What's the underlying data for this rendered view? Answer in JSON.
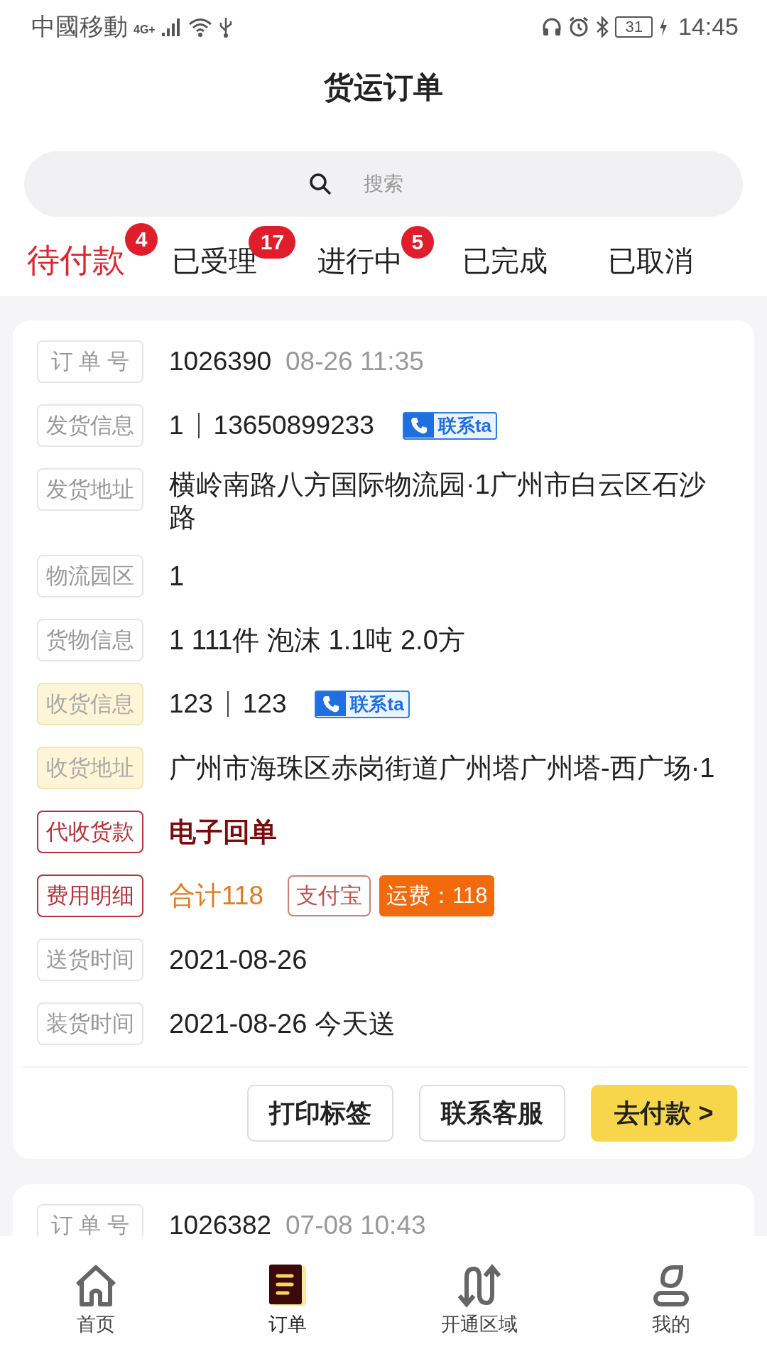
{
  "status_bar": {
    "carrier": "中國移動",
    "network": "4G+",
    "battery": "31",
    "time": "14:45"
  },
  "header": {
    "title": "货运订单"
  },
  "search": {
    "placeholder": "搜索"
  },
  "tabs": [
    {
      "label": "待付款",
      "badge": "4",
      "selected": true
    },
    {
      "label": "已受理",
      "badge": "17",
      "selected": false
    },
    {
      "label": "进行中",
      "badge": "5",
      "selected": false
    },
    {
      "label": "已完成",
      "selected": false
    },
    {
      "label": "已取消",
      "selected": false
    }
  ],
  "orders": [
    {
      "rows": [
        {
          "kind": "order",
          "label": "订 单 号",
          "highlighted": false,
          "alert": false,
          "number": "1026390",
          "time": "08-26 11:35"
        },
        {
          "kind": "contact",
          "label": "发货信息",
          "highlighted": false,
          "alert": false,
          "name": "1",
          "phone": "13650899233",
          "button": "联系ta"
        },
        {
          "kind": "text",
          "label": "发货地址",
          "highlighted": false,
          "alert": false,
          "value": "横岭南路八方国际物流园·1广州市白云区石沙路"
        },
        {
          "kind": "text",
          "label": "物流园区",
          "highlighted": false,
          "alert": false,
          "value": "1"
        },
        {
          "kind": "text",
          "label": "货物信息",
          "highlighted": false,
          "alert": false,
          "value": "1 111件 泡沫 1.1吨 2.0方"
        },
        {
          "kind": "contact",
          "label": "收货信息",
          "highlighted": true,
          "alert": false,
          "name": "123",
          "phone": "123",
          "button": "联系ta"
        },
        {
          "kind": "text",
          "label": "收货地址",
          "highlighted": true,
          "alert": false,
          "value": "广州市海珠区赤岗街道广州塔广州塔-西广场·1"
        },
        {
          "kind": "strong",
          "label": "代收货款",
          "highlighted": false,
          "alert": true,
          "value": "电子回单"
        },
        {
          "kind": "fee",
          "label": "费用明细",
          "highlighted": false,
          "alert": true,
          "total": "合计118",
          "method": "支付宝",
          "fee": "运费：118"
        },
        {
          "kind": "text",
          "label": "送货时间",
          "highlighted": false,
          "alert": false,
          "value": "2021-08-26"
        },
        {
          "kind": "text",
          "label": "装货时间",
          "highlighted": false,
          "alert": false,
          "value": "2021-08-26 今天送"
        }
      ],
      "actions": [
        {
          "label": "打印标签",
          "primary": false
        },
        {
          "label": "联系客服",
          "primary": false
        },
        {
          "label": "去付款 >",
          "primary": true
        }
      ]
    },
    {
      "rows": [
        {
          "kind": "order",
          "label": "订 单 号",
          "highlighted": false,
          "alert": false,
          "number": "1026382",
          "time": "07-08 10:43"
        }
      ]
    }
  ],
  "nav": [
    {
      "kind": "home",
      "label": "首页",
      "selected": false
    },
    {
      "kind": "orders",
      "label": "订单",
      "selected": true
    },
    {
      "kind": "route",
      "label": "开通区域",
      "selected": false
    },
    {
      "kind": "person",
      "label": "我的",
      "selected": false
    }
  ]
}
